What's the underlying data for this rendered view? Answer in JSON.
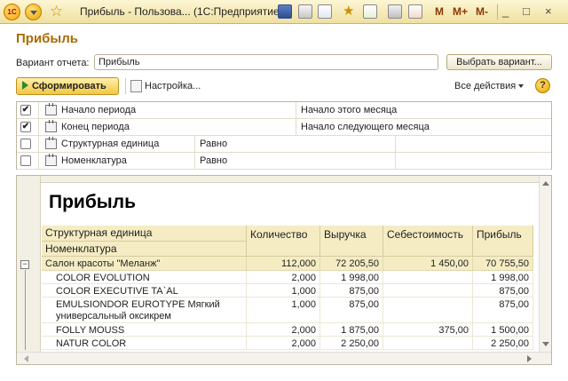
{
  "window": {
    "title": "Прибыль - Пользова...  (1С:Предприятие)",
    "logo": "1С",
    "memory_buttons": [
      "M",
      "M+",
      "M-"
    ],
    "controls": [
      "_",
      "□",
      "×"
    ]
  },
  "page": {
    "heading": "Прибыль",
    "variant_label": "Вариант отчета:",
    "variant_value": "Прибыль",
    "choose_variant_label": "Выбрать вариант...",
    "generate_label": "Сформировать",
    "settings_label": "Настройка...",
    "all_actions_label": "Все действия",
    "help_label": "?"
  },
  "parameters": [
    {
      "checked": true,
      "mark": "✔",
      "label": "Начало периода",
      "value": "Начало этого месяца"
    },
    {
      "checked": true,
      "mark": "✔",
      "label": "Конец периода",
      "value": "Начало следующего месяца"
    },
    {
      "checked": false,
      "mark": "",
      "label": "Структурная единица",
      "value": "Равно"
    },
    {
      "checked": false,
      "mark": "",
      "label": "Номенклатура",
      "value": "Равно"
    }
  ],
  "report": {
    "title": "Прибыль",
    "collapse_symbol": "−",
    "headers": {
      "col1_line1": "Структурная единица",
      "col1_line2": "Номенклатура",
      "quantity": "Количество",
      "revenue": "Выручка",
      "cost": "Себестоимость",
      "profit": "Прибыль"
    },
    "group": {
      "name": "Салон красоты \"Меланж\"",
      "quantity": "112,000",
      "revenue": "72 205,50",
      "cost": "1 450,00",
      "profit": "70 755,50"
    },
    "rows": [
      {
        "name": "COLOR EVOLUTION",
        "quantity": "2,000",
        "revenue": "1 998,00",
        "cost": "",
        "profit": "1 998,00"
      },
      {
        "name": "COLOR EXECUTIVE TA`AL",
        "quantity": "1,000",
        "revenue": "875,00",
        "cost": "",
        "profit": "875,00"
      },
      {
        "name": "EMULSIONDOR EUROTYPE Мягкий универсальный оксикрем",
        "quantity": "1,000",
        "revenue": "875,00",
        "cost": "",
        "profit": "875,00"
      },
      {
        "name": "FOLLY MOUSS",
        "quantity": "2,000",
        "revenue": "1 875,00",
        "cost": "375,00",
        "profit": "1 500,00"
      },
      {
        "name": "NATUR COLOR",
        "quantity": "2,000",
        "revenue": "2 250,00",
        "cost": "",
        "profit": "2 250,00"
      }
    ]
  }
}
